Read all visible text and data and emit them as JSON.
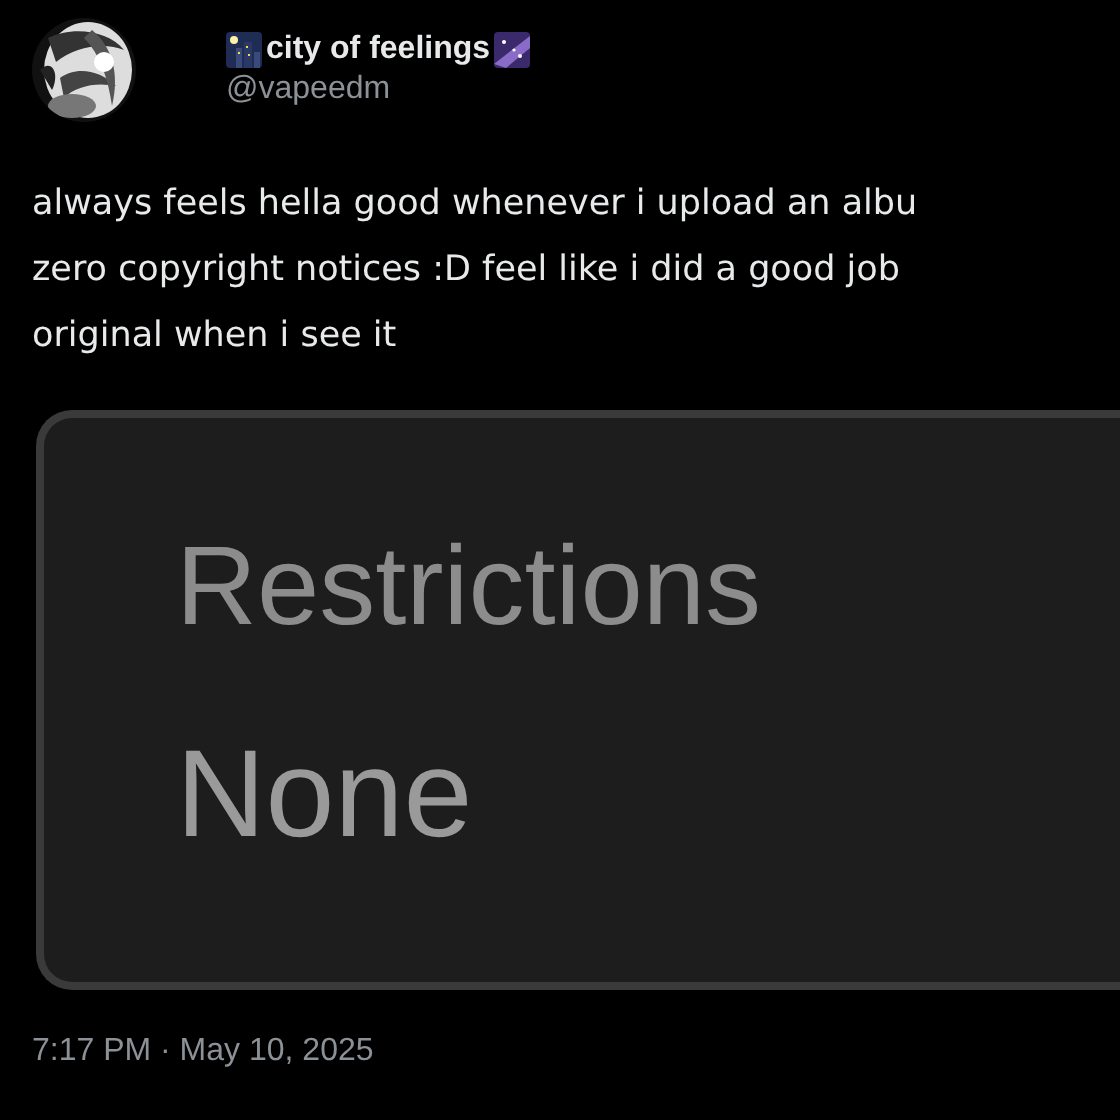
{
  "author": {
    "display_name": "city of feelings",
    "handle": "@vapeedm"
  },
  "tweet": {
    "lines": [
      "always feels hella good whenever i upload an albu",
      "zero copyright notices :D feel like i did a good job",
      "original when i see it"
    ]
  },
  "media": {
    "kind": "screenshot",
    "label": "Restrictions",
    "value": "None"
  },
  "timestamp": "7:17 PM · May 10, 2025"
}
